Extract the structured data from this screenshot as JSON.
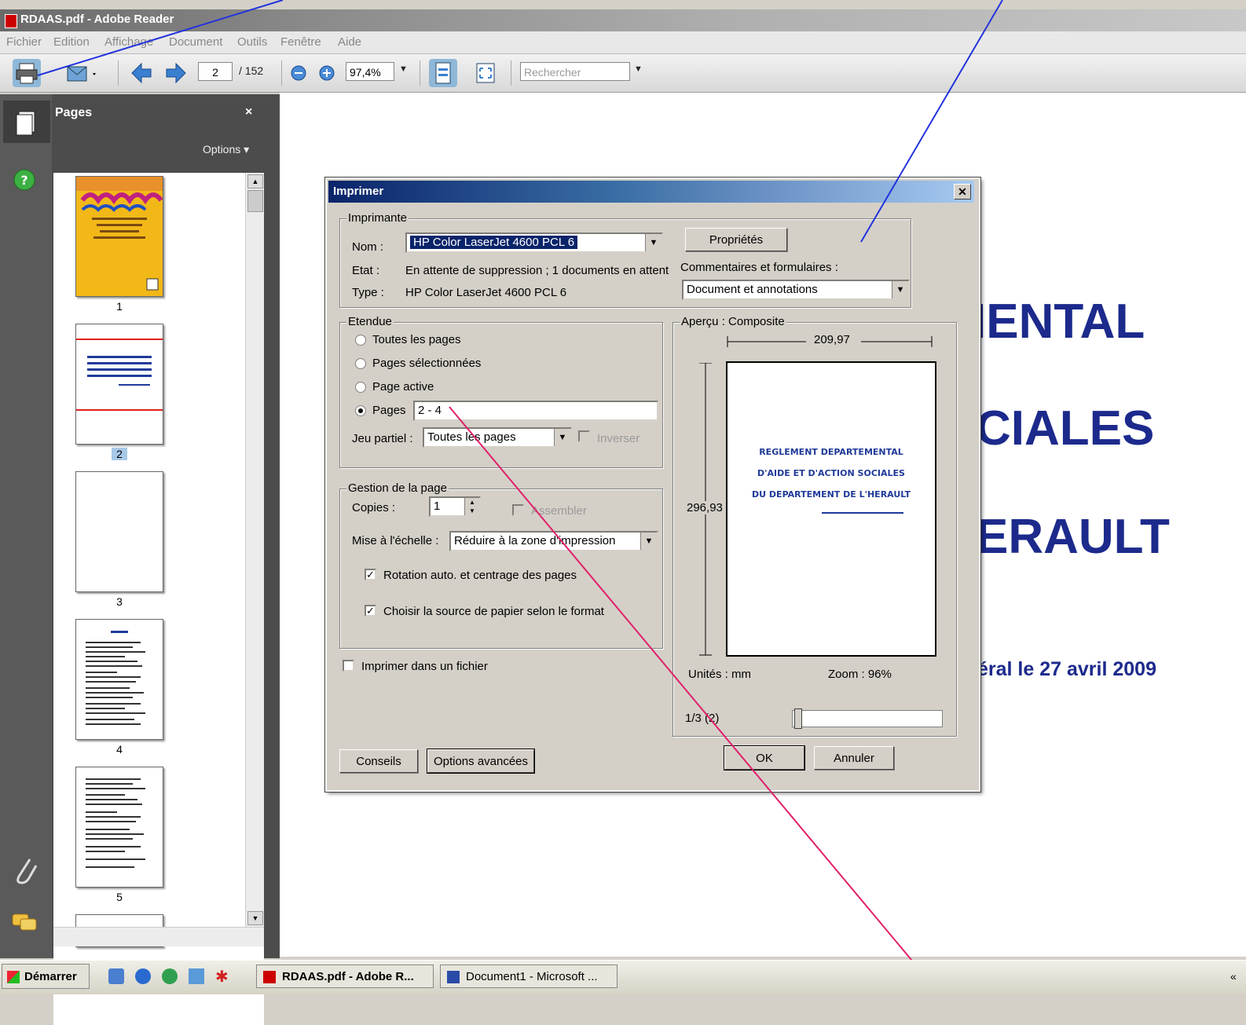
{
  "window": {
    "title": "RDAAS.pdf - Adobe Reader"
  },
  "menu": [
    "Fichier",
    "Edition",
    "Affichage",
    "Document",
    "Outils",
    "Fenêtre",
    "Aide"
  ],
  "toolbar": {
    "page_current": "2",
    "page_total": "/ 152",
    "zoom": "97,4%",
    "search_placeholder": "Rechercher"
  },
  "pages_panel": {
    "title": "Pages",
    "close": "×",
    "options": "Options ▾",
    "thumbnail_numbers": [
      "1",
      "2",
      "3",
      "4",
      "5"
    ],
    "selected": "2"
  },
  "document": {
    "line1": "IENTAL",
    "line2": "CIALES",
    "line3": "ERAULT",
    "date_line": "éral le 27 avril 2009"
  },
  "dialog": {
    "title": "Imprimer",
    "printer": {
      "group": "Imprimante",
      "name_label": "Nom :",
      "name_value": "HP Color LaserJet 4600 PCL 6",
      "properties_button": "Propriétés",
      "state_label": "Etat :",
      "state_value": "En attente de suppression ; 1 documents en attent",
      "type_label": "Type :",
      "type_value": "HP Color LaserJet 4600 PCL 6",
      "comments_label": "Commentaires et formulaires :",
      "comments_value": "Document et annotations"
    },
    "range": {
      "group": "Etendue",
      "options": [
        "Toutes les pages",
        "Pages sélectionnées",
        "Page active",
        "Pages"
      ],
      "selected_option": "Pages",
      "pages_value": "2 - 4",
      "subset_label": "Jeu partiel :",
      "subset_value": "Toutes les pages",
      "reverse_label": "Inverser"
    },
    "handling": {
      "group": "Gestion de la page",
      "copies_label": "Copies :",
      "copies_value": "1",
      "collate_label": "Assembler",
      "scale_label": "Mise à l'échelle :",
      "scale_value": "Réduire à la zone d'impression",
      "auto_rotate_label": "Rotation auto. et centrage des pages",
      "paper_source_label": "Choisir la source de papier selon le format"
    },
    "print_to_file_label": "Imprimer dans un fichier",
    "preview": {
      "group": "Aperçu : Composite",
      "width": "209,97",
      "height": "296,93",
      "units": "Unités : mm",
      "zoom": "Zoom : 96%",
      "page_counter": "1/3 (2)",
      "page_lines": [
        "REGLEMENT DEPARTEMENTAL",
        "D'AIDE ET D'ACTION SOCIALES",
        "DU DEPARTEMENT DE L'HERAULT"
      ]
    },
    "buttons": {
      "tips": "Conseils",
      "advanced": "Options avancées",
      "ok": "OK",
      "cancel": "Annuler"
    }
  },
  "taskbar": {
    "start": "Démarrer",
    "tasks": [
      "RDAAS.pdf - Adobe R...",
      "Document1 - Microsoft ..."
    ],
    "tray": "«"
  },
  "colors": {
    "doc_text": "#1c2a8c",
    "annotation_blue": "#2233dd",
    "annotation_pink": "#e0206a"
  }
}
